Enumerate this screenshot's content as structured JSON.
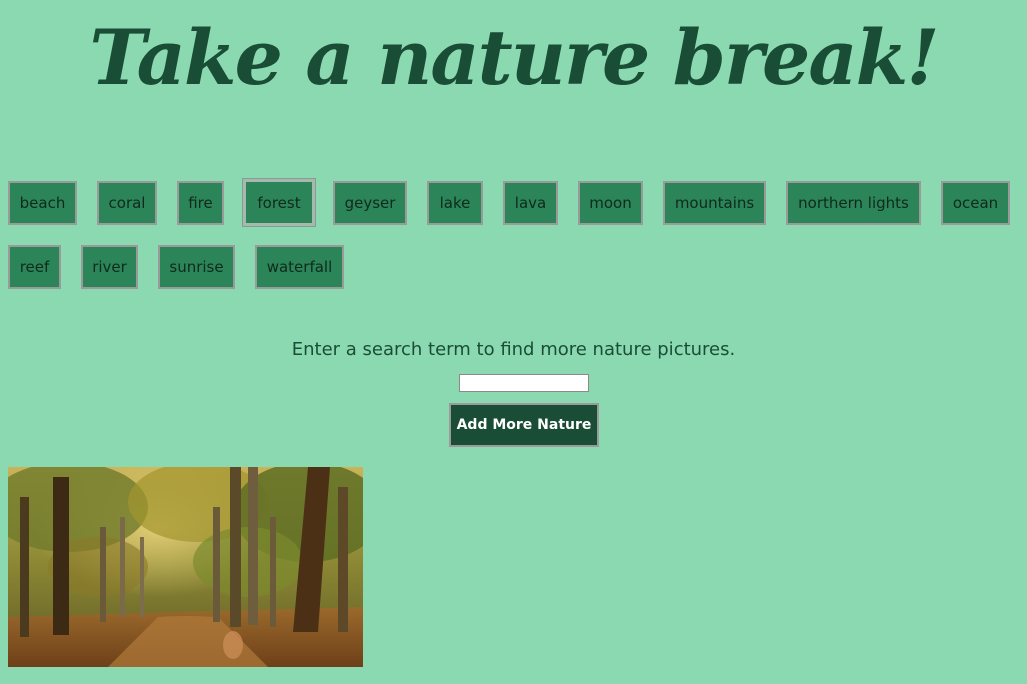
{
  "header": {
    "title": "Take a nature break!"
  },
  "topics": [
    {
      "label": "beach"
    },
    {
      "label": "coral"
    },
    {
      "label": "fire"
    },
    {
      "label": "forest",
      "active": true
    },
    {
      "label": "geyser"
    },
    {
      "label": "lake"
    },
    {
      "label": "lava"
    },
    {
      "label": "moon"
    },
    {
      "label": "mountains"
    },
    {
      "label": "northern lights"
    },
    {
      "label": "ocean"
    },
    {
      "label": "reef"
    },
    {
      "label": "river"
    },
    {
      "label": "sunrise"
    },
    {
      "label": "waterfall"
    }
  ],
  "search": {
    "prompt": "Enter a search term to find more nature pictures.",
    "value": "",
    "button_label": "Add More Nature"
  },
  "gallery": {
    "current_topic": "forest"
  },
  "colors": {
    "background": "#8bd9b1",
    "title": "#1a4d36",
    "topic_button": "#2b8559",
    "add_button": "#1a4d36"
  }
}
